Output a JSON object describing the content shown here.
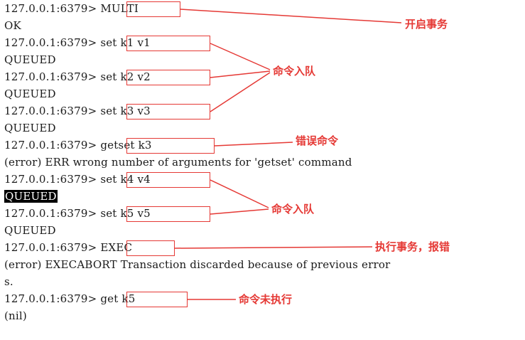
{
  "terminal": {
    "lines": [
      "127.0.0.1:6379> MULTI",
      "OK",
      "127.0.0.1:6379> set k1 v1",
      "QUEUED",
      "127.0.0.1:6379> set k2 v2",
      "QUEUED",
      "127.0.0.1:6379> set k3 v3",
      "QUEUED",
      "127.0.0.1:6379> getset k3",
      "(error) ERR wrong number of arguments for 'getset' command",
      "127.0.0.1:6379> set k4 v4",
      "QUEUED",
      "127.0.0.1:6379> set k5 v5",
      "QUEUED",
      "127.0.0.1:6379> EXEC",
      "(error) EXECABORT Transaction discarded because of previous error",
      "s.",
      "127.0.0.1:6379> get k5",
      "(nil)"
    ],
    "highlighted_line": 11
  },
  "annotations": {
    "start_transaction": "开启事务",
    "queue_1": "命令入队",
    "error_command": "错误命令",
    "queue_2": "命令入队",
    "exec_error": "执行事务，报错",
    "not_executed": "命令未执行"
  },
  "colors": {
    "annotation": "#e53935",
    "text": "#1a1a1a",
    "highlight_bg": "#000000",
    "highlight_fg": "#ffffff"
  }
}
